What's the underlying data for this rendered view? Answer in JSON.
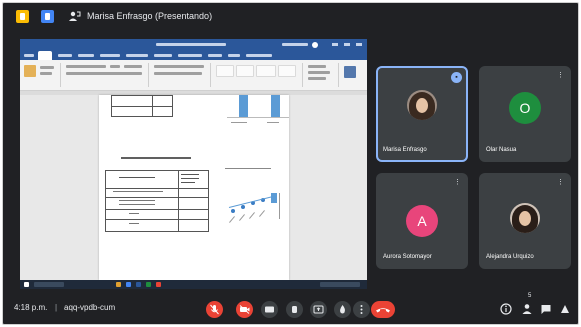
{
  "topbar": {
    "presenter_label": "Marisa Enfrasgo (Presentando)"
  },
  "participants": [
    {
      "name": "Marisa Enfrasgo",
      "kind": "photo",
      "hair": "#3a2a20",
      "bg": "#2f3134"
    },
    {
      "name": "Olar Nasua",
      "kind": "initial",
      "initial": "O",
      "color": "#1e8e3e"
    },
    {
      "name": "Aurora Sotomayor",
      "kind": "initial",
      "initial": "A",
      "color": "#e8457b"
    },
    {
      "name": "Alejandra Urquizo",
      "kind": "photo",
      "hair": "#2a1e18",
      "bg": "#3c4043"
    }
  ],
  "tile_badges": {
    "more": "⋮",
    "speaking": "▪"
  },
  "bottombar": {
    "time": "4:18 p.m.",
    "separator": "|",
    "meeting_code": "aqq-vpdb-cum",
    "people_count": "5"
  },
  "controls": {
    "mic": "🎤",
    "camera": "▣",
    "end_call": "☎"
  },
  "colors": {
    "background": "#202124",
    "tile": "#3c4043",
    "accent": "#8ab4f8",
    "danger": "#ea4335",
    "word_blue": "#2b579a"
  }
}
